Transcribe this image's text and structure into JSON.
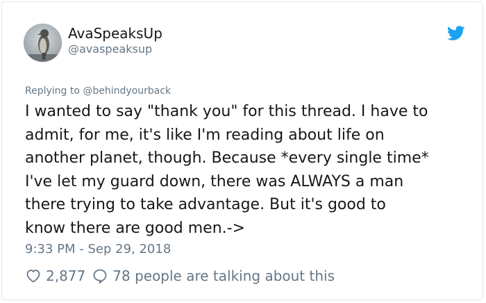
{
  "tweet": {
    "author": {
      "display_name": "AvaSpeaksUp",
      "handle": "@avaspeaksup",
      "avatar_icon": "bird-photo-avatar"
    },
    "brand_icon": "twitter-bird-icon",
    "brand_color": "#1da1f2",
    "replying_to": "Replying to @behindyourback",
    "text_lines": [
      "I wanted to say \"thank you\" for this thread. I have to",
      "admit, for me, it's like I'm reading about life on",
      "another planet, though. Because *every single time*",
      "I've let my guard down, there was ALWAYS a man",
      "there trying to take advantage. But it's good to",
      "know there are good men.->"
    ],
    "timestamp": "9:33 PM - Sep 29, 2018",
    "likes": {
      "icon": "heart-icon",
      "count": "2,877"
    },
    "replies": {
      "icon": "speech-bubble-icon",
      "text": "78 people are talking about this"
    }
  }
}
